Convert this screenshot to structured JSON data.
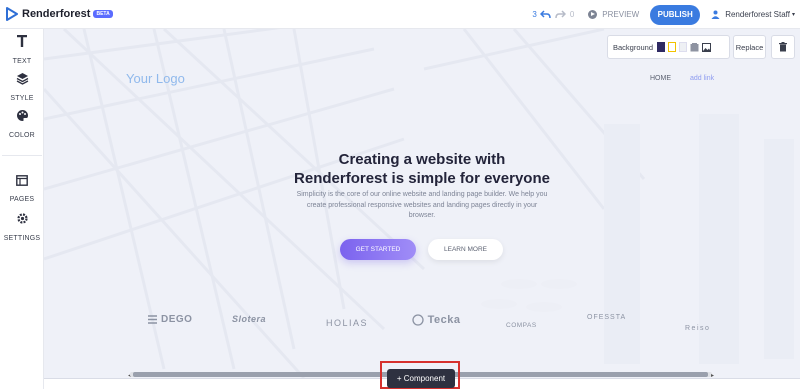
{
  "app": {
    "name": "Renderforest",
    "badge": "BETA"
  },
  "topbar": {
    "undo_count": "3",
    "redo_count": "0",
    "preview_label": "PREVIEW",
    "publish_label": "PUBLISH",
    "user_name": "Renderforest Staff",
    "caret": "▾"
  },
  "sidebar": {
    "items": [
      {
        "label": "TEXT"
      },
      {
        "label": "STYLE"
      },
      {
        "label": "COLOR"
      },
      {
        "label": "PAGES"
      },
      {
        "label": "SETTINGS"
      }
    ]
  },
  "editor_toolbar": {
    "background_label": "Background",
    "replace_label": "Replace",
    "swatch_colors": [
      "#2f2a63",
      "#ffffff",
      "#eef0f4"
    ]
  },
  "site": {
    "logo": "Your Logo",
    "nav": [
      "HOME",
      "add link"
    ],
    "hero_title_line1": "Creating a website with",
    "hero_title_line2": "Renderforest is simple for everyone",
    "hero_subtitle": "Simplicity is the core of our online website and landing page builder. We help you create professional responsive websites and landing pages directly in your browser.",
    "primary_cta": "GET STARTED",
    "secondary_cta": "LEARN MORE",
    "partners": [
      "DEGO",
      "Slotera",
      "HOLIAS",
      "Tecka",
      "COMPAS",
      "OFESSTA",
      "Reiso"
    ]
  },
  "add_component_label": "+ Component",
  "colors": {
    "accent": "#3a7be0",
    "cta_gradient_start": "#7b63ee",
    "highlight": "#d6312e"
  }
}
